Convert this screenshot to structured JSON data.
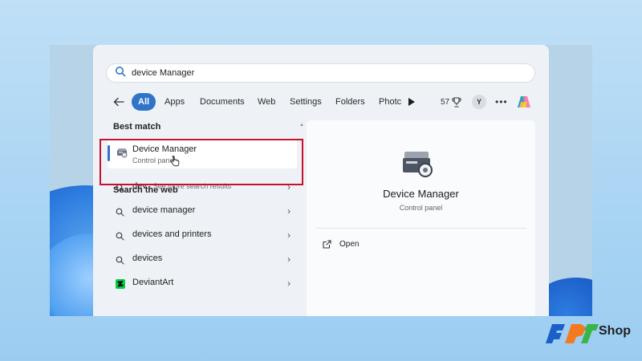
{
  "search": {
    "value": "device Manager",
    "icon": "search-icon"
  },
  "filters": {
    "back_icon": "arrow-left-icon",
    "chips": [
      "All",
      "Apps",
      "Documents",
      "Web",
      "Settings",
      "Folders",
      "Photc"
    ],
    "active": "All",
    "play_icon": "play-icon",
    "reward_count": "57",
    "reward_icon": "trophy-icon",
    "avatar_initial": "Y",
    "more_label": "•••",
    "copilot_icon": "copilot-icon"
  },
  "best_match": {
    "heading": "Best match",
    "title": "Device Manager",
    "subtitle": "Control panel",
    "icon": "device-manager-icon"
  },
  "search_web": {
    "heading": "Search the web",
    "items": [
      {
        "label": "dev",
        "suffix": " - See more search results",
        "icon": "search-icon"
      },
      {
        "label": "device manager",
        "suffix": "",
        "icon": "search-icon"
      },
      {
        "label": "devices and printers",
        "suffix": "",
        "icon": "search-icon"
      },
      {
        "label": "devices",
        "suffix": "",
        "icon": "search-icon"
      },
      {
        "label": "DeviantArt",
        "suffix": "",
        "icon": "deviantart-icon"
      }
    ]
  },
  "detail": {
    "title": "Device Manager",
    "subtitle": "Control panel",
    "actions": [
      {
        "label": "Open",
        "icon": "open-external-icon"
      }
    ]
  },
  "brand": {
    "logo_text": "FPT",
    "shop_text": "Shop",
    "colors": {
      "blue": "#1b5fc9",
      "orange": "#f47a20",
      "green": "#39b54a"
    }
  },
  "colors": {
    "accent": "#2f74c9",
    "highlight": "#c8102e"
  }
}
